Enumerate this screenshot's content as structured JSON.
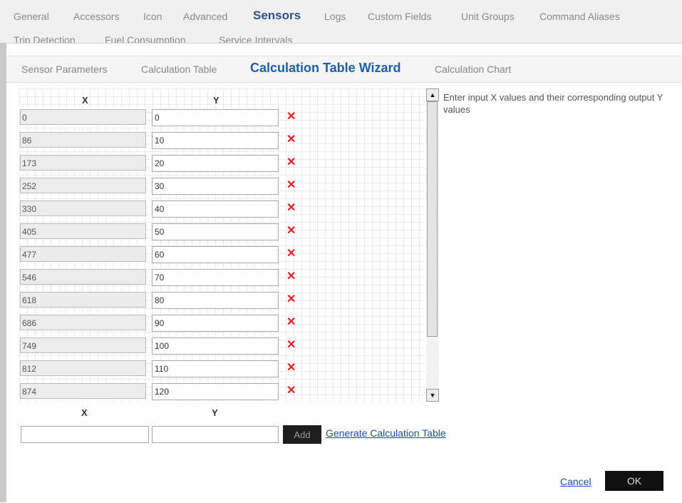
{
  "top_tabs": {
    "row1": [
      "General",
      "Accessors",
      "Icon",
      "Advanced",
      "Sensors",
      "Logs",
      "Custom Fields",
      "Unit Groups",
      "Command Aliases"
    ],
    "row2": [
      "Trip Detection",
      "Fuel Consumption",
      "Service Intervals"
    ],
    "active": "Sensors"
  },
  "sub_tabs": [
    "Sensor Parameters",
    "Calculation Table",
    "Calculation Table Wizard",
    "Calculation Chart"
  ],
  "active_sub_tab": "Calculation Table Wizard",
  "table": {
    "x_header": "X",
    "y_header": "Y",
    "rows": [
      {
        "x": "0",
        "y": "0"
      },
      {
        "x": "86",
        "y": "10"
      },
      {
        "x": "173",
        "y": "20"
      },
      {
        "x": "252",
        "y": "30"
      },
      {
        "x": "330",
        "y": "40"
      },
      {
        "x": "405",
        "y": "50"
      },
      {
        "x": "477",
        "y": "60"
      },
      {
        "x": "546",
        "y": "70"
      },
      {
        "x": "618",
        "y": "80"
      },
      {
        "x": "686",
        "y": "90"
      },
      {
        "x": "749",
        "y": "100"
      },
      {
        "x": "812",
        "y": "110"
      },
      {
        "x": "874",
        "y": "120"
      }
    ],
    "delete_glyph": "✕"
  },
  "instructions": "Enter input X values and their corresponding output Y values",
  "add_row": {
    "x_header": "X",
    "y_header": "Y",
    "x_value": "",
    "y_value": "",
    "add_label": "Add",
    "generate_label": "Generate Calculation Table"
  },
  "footer": {
    "cancel_label": "Cancel",
    "ok_label": "OK"
  },
  "colors": {
    "accent": "#1f5ea8",
    "delete": "#e02020",
    "button_bg": "#101010"
  }
}
